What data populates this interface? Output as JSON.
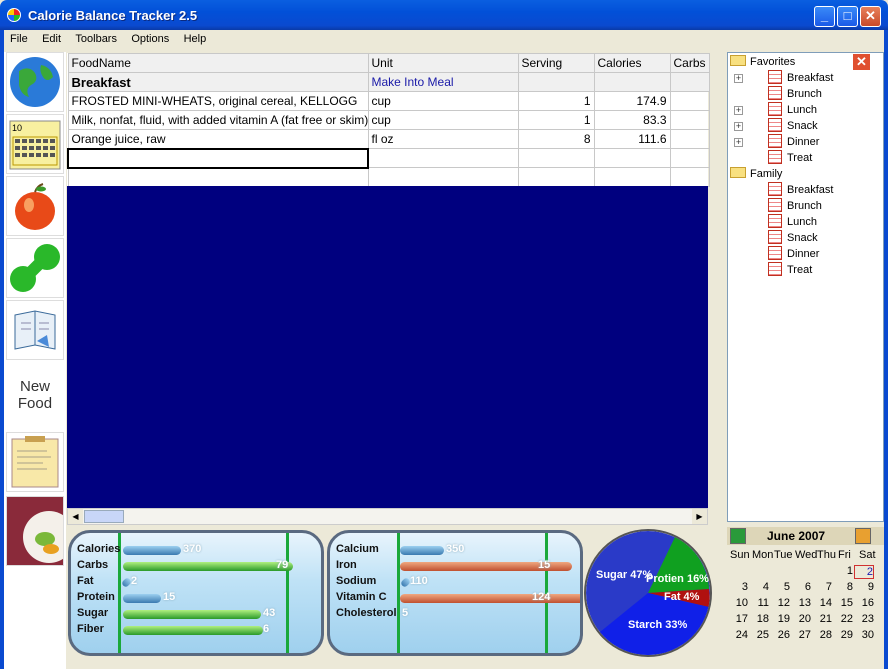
{
  "window": {
    "title": "Calorie Balance Tracker 2.5",
    "min": "_",
    "max": "□",
    "close": "✕"
  },
  "menu": [
    "File",
    "Edit",
    "Toolbars",
    "Options",
    "Help"
  ],
  "toolbar": {
    "new_food": "New Food",
    "calendar_mini": "10"
  },
  "grid": {
    "headers": [
      "FoodName",
      "Unit",
      "Serving",
      "Calories",
      "Carbs"
    ],
    "meal": {
      "name": "Breakfast",
      "action": "Make Into Meal"
    },
    "rows": [
      {
        "food": "FROSTED MINI-WHEATS, original cereal, KELLOGG",
        "unit": "cup",
        "serving": "1",
        "calories": "174.9"
      },
      {
        "food": "Milk, nonfat, fluid, with added vitamin A (fat free or skim)",
        "unit": "cup",
        "serving": "1",
        "calories": "83.3"
      },
      {
        "food": "Orange juice, raw",
        "unit": "fl oz",
        "serving": "8",
        "calories": "111.6"
      }
    ]
  },
  "tree": {
    "groups": [
      {
        "name": "Favorites",
        "items": [
          "Breakfast",
          "Brunch",
          "Lunch",
          "Snack",
          "Dinner",
          "Treat"
        ]
      },
      {
        "name": "Family",
        "items": [
          "Breakfast",
          "Brunch",
          "Lunch",
          "Snack",
          "Dinner",
          "Treat"
        ]
      }
    ]
  },
  "nutrition_left": [
    {
      "label": "Calories",
      "value": "370"
    },
    {
      "label": "Carbs",
      "value": "79"
    },
    {
      "label": "Fat",
      "value": "2"
    },
    {
      "label": "Protein",
      "value": "15"
    },
    {
      "label": "Sugar",
      "value": "43"
    },
    {
      "label": "Fiber",
      "value": "6"
    }
  ],
  "nutrition_right": [
    {
      "label": "Calcium",
      "value": "350"
    },
    {
      "label": "Iron",
      "value": "15"
    },
    {
      "label": "Sodium",
      "value": "110"
    },
    {
      "label": "Vitamin C",
      "value": "124"
    },
    {
      "label": "Cholesterol",
      "value": "5"
    }
  ],
  "pie": [
    {
      "label": "Sugar 47%",
      "color": "#2a3ac8"
    },
    {
      "label": "Protien 16%",
      "color": "#10a020"
    },
    {
      "label": "Fat 4%",
      "color": "#b01010"
    },
    {
      "label": "Starch 33%",
      "color": "#1020e8"
    }
  ],
  "calendar": {
    "month": "June 2007",
    "days": [
      "Sun",
      "Mon",
      "Tue",
      "Wed",
      "Thu",
      "Fri",
      "Sat"
    ],
    "weeks": [
      [
        "",
        "",
        "",
        "",
        "",
        "1",
        "2"
      ],
      [
        "3",
        "4",
        "5",
        "6",
        "7",
        "8",
        "9"
      ],
      [
        "10",
        "11",
        "12",
        "13",
        "14",
        "15",
        "16"
      ],
      [
        "17",
        "18",
        "19",
        "20",
        "21",
        "22",
        "23"
      ],
      [
        "24",
        "25",
        "26",
        "27",
        "28",
        "29",
        "30"
      ]
    ],
    "today": "2"
  }
}
